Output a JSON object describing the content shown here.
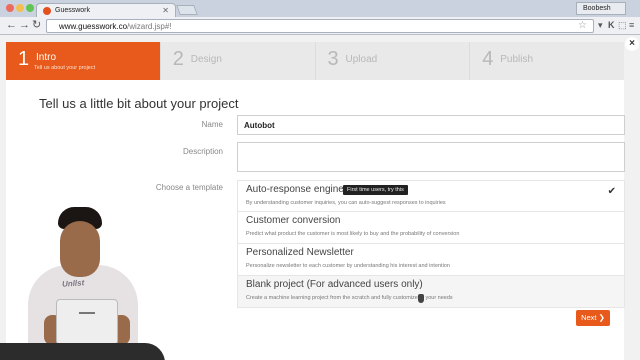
{
  "browser": {
    "tab_title": "Guesswork",
    "tab_close": "✕",
    "user_name": "Boobesh",
    "url_host": "www.guesswork.co",
    "url_path": "/wizard.jsp#!",
    "back_glyph": "←",
    "forward_glyph": "→",
    "reload_glyph": "↻",
    "star_glyph": "☆",
    "ext_glyphs": [
      "▾",
      "K",
      "⬚",
      "≡"
    ],
    "traffic_colors": [
      "#ec6a5e",
      "#f4bf4f",
      "#61c554"
    ]
  },
  "wizard": {
    "steps": [
      {
        "num": "1",
        "label": "Intro",
        "sub": "Tell us about your project",
        "active": true
      },
      {
        "num": "2",
        "label": "Design",
        "active": false
      },
      {
        "num": "3",
        "label": "Upload",
        "active": false
      },
      {
        "num": "4",
        "label": "Publish",
        "active": false
      }
    ],
    "close_glyph": "×",
    "heading": "Tell us a little bit about your project",
    "name_label": "Name",
    "name_value": "Autobot",
    "description_label": "Description",
    "description_value": "",
    "template_label": "Choose a template",
    "templates": [
      {
        "name": "Auto-response engine",
        "desc": "By understanding customer inquiries, you can auto-suggest responses to inquiries",
        "tooltip": "First time users, try this",
        "selected": true
      },
      {
        "name": "Customer conversion",
        "desc": "Predict what product the customer is most likely to buy and the probability of conversion",
        "selected": false
      },
      {
        "name": "Personalized Newsletter",
        "desc": "Personalize newsletter to each customer by understanding his interest and intention",
        "selected": false
      },
      {
        "name": "Blank project (For advanced users only)",
        "desc": "Create a machine learning project from the scratch and fully customize to your needs",
        "selected": false
      }
    ],
    "check_glyph": "✔",
    "next_label": "Next ❯",
    "accent": "#e85a1b"
  },
  "webcam": {
    "shirt_text": "Unllst"
  }
}
